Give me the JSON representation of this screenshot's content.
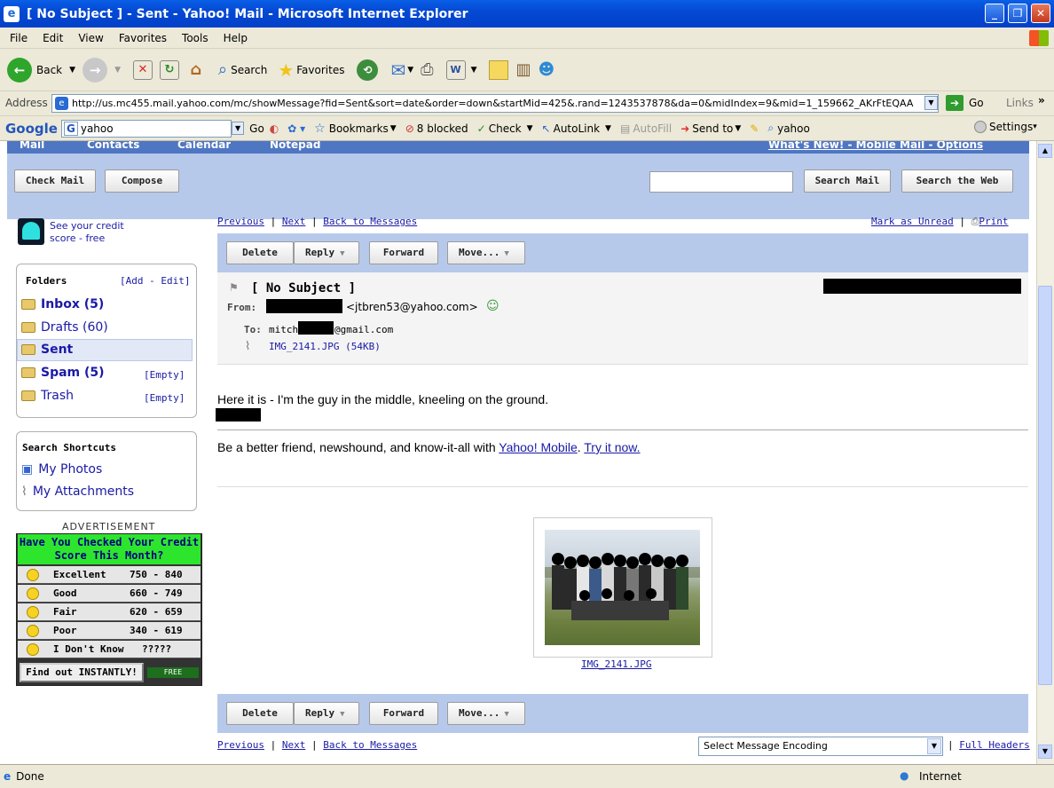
{
  "window": {
    "title": "[ No Subject ] - Sent - Yahoo! Mail - Microsoft Internet Explorer"
  },
  "menu": [
    "File",
    "Edit",
    "View",
    "Favorites",
    "Tools",
    "Help"
  ],
  "toolbar": {
    "back": "Back",
    "search": "Search",
    "favorites": "Favorites"
  },
  "address": {
    "label": "Address",
    "url": "http://us.mc455.mail.yahoo.com/mc/showMessage?fid=Sent&sort=date&order=down&startMid=425&.rand=1243537878&da=0&midIndex=9&mid=1_159662_AKrFtEQAA",
    "go": "Go",
    "links": "Links"
  },
  "google": {
    "logo": "Google",
    "query": "yahoo",
    "go": "Go",
    "bookmarks": "Bookmarks",
    "blocked": "8 blocked",
    "check": "Check",
    "autolink": "AutoLink",
    "autofill": "AutoFill",
    "sendto": "Send to",
    "yahoo": "yahoo",
    "settings": "Settings"
  },
  "yahoo": {
    "tabs": [
      "Mail",
      "Contacts",
      "Calendar",
      "Notepad"
    ],
    "toplinks": "What's New! - Mobile Mail - Options",
    "check_mail": "Check Mail",
    "compose": "Compose",
    "search_mail": "Search Mail",
    "search_web": "Search the Web",
    "credit_promo": "See your credit score - free",
    "folders_title": "Folders",
    "folders_edit": "[Add - Edit]",
    "folders": [
      {
        "name": "Inbox (5)",
        "bold": true
      },
      {
        "name": "Drafts (60)"
      },
      {
        "name": "Sent",
        "bold": true
      },
      {
        "name": "Spam (5)",
        "bold": true,
        "action": "[Empty]"
      },
      {
        "name": "Trash",
        "action": "[Empty]"
      }
    ],
    "shortcuts_title": "Search Shortcuts",
    "shortcuts": [
      "My Photos",
      "My Attachments"
    ],
    "ad": {
      "label": "ADVERTISEMENT",
      "headline": "Have You Checked Your Credit Score This Month?",
      "rows": [
        {
          "label": "Excellent",
          "range": "750 - 840"
        },
        {
          "label": "Good",
          "range": "660 - 749"
        },
        {
          "label": "Fair",
          "range": "620 - 659"
        },
        {
          "label": "Poor",
          "range": "340 - 619"
        },
        {
          "label": "I Don't Know",
          "range": "?????"
        }
      ],
      "cta": "Find out INSTANTLY!",
      "brand": "FREE score.com"
    },
    "nav": {
      "previous": "Previous",
      "next": "Next",
      "back": "Back to Messages",
      "mark_unread": "Mark as Unread",
      "print": "Print"
    },
    "actions": {
      "delete": "Delete",
      "reply": "Reply",
      "forward": "Forward",
      "move": "Move..."
    },
    "message": {
      "subject": "[ No Subject ]",
      "from_label": "From:",
      "from_email": "<jtbren53@yahoo.com>",
      "to_label": "To:",
      "to_prefix": "mitch",
      "to_suffix": "@gmail.com",
      "attachment": "IMG_2141.JPG (54KB)",
      "body": "Here it is - I'm the guy in the middle, kneeling on the ground.",
      "promo_text": "Be a better friend, newshound, and know-it-all with",
      "promo_link1": "Yahoo! Mobile",
      "promo_link2": "Try it now.",
      "image_caption": "IMG_2141.JPG"
    },
    "encoding": "Select Message Encoding",
    "full_headers": "Full Headers"
  },
  "status": {
    "text": "Done",
    "zone": "Internet"
  }
}
